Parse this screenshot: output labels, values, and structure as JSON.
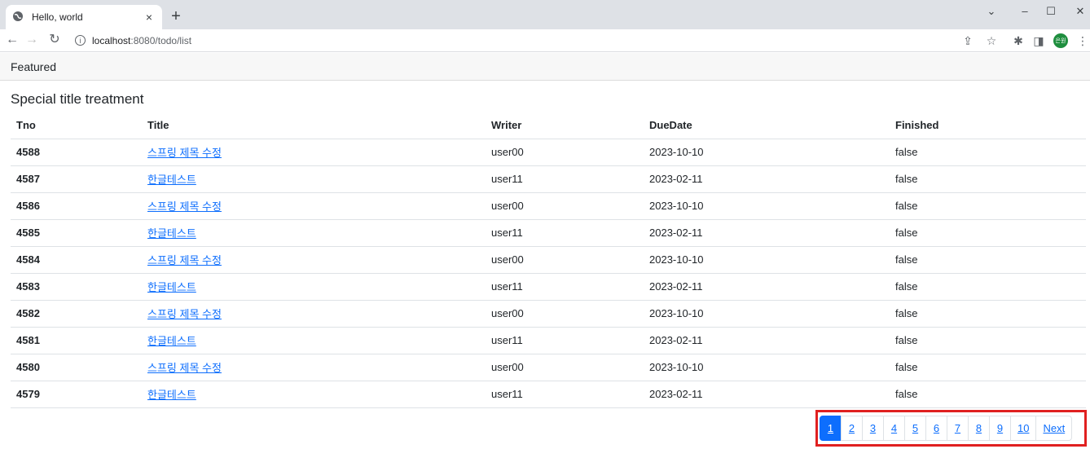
{
  "browser": {
    "tab_title": "Hello, world",
    "tab_close": "×",
    "new_tab": "+",
    "url_host": "localhost",
    "url_path": ":8080/todo/list",
    "avatar_text": "은원"
  },
  "card": {
    "header": "Featured",
    "title": "Special title treatment"
  },
  "table": {
    "columns": [
      "Tno",
      "Title",
      "Writer",
      "DueDate",
      "Finished"
    ],
    "rows": [
      {
        "tno": "4588",
        "title": "스프링 제목 수정",
        "writer": "user00",
        "dueDate": "2023-10-10",
        "finished": "false"
      },
      {
        "tno": "4587",
        "title": "한글테스트",
        "writer": "user11",
        "dueDate": "2023-02-11",
        "finished": "false"
      },
      {
        "tno": "4586",
        "title": "스프링 제목 수정",
        "writer": "user00",
        "dueDate": "2023-10-10",
        "finished": "false"
      },
      {
        "tno": "4585",
        "title": "한글테스트",
        "writer": "user11",
        "dueDate": "2023-02-11",
        "finished": "false"
      },
      {
        "tno": "4584",
        "title": "스프링 제목 수정",
        "writer": "user00",
        "dueDate": "2023-10-10",
        "finished": "false"
      },
      {
        "tno": "4583",
        "title": "한글테스트",
        "writer": "user11",
        "dueDate": "2023-02-11",
        "finished": "false"
      },
      {
        "tno": "4582",
        "title": "스프링 제목 수정",
        "writer": "user00",
        "dueDate": "2023-10-10",
        "finished": "false"
      },
      {
        "tno": "4581",
        "title": "한글테스트",
        "writer": "user11",
        "dueDate": "2023-02-11",
        "finished": "false"
      },
      {
        "tno": "4580",
        "title": "스프링 제목 수정",
        "writer": "user00",
        "dueDate": "2023-10-10",
        "finished": "false"
      },
      {
        "tno": "4579",
        "title": "한글테스트",
        "writer": "user11",
        "dueDate": "2023-02-11",
        "finished": "false"
      }
    ]
  },
  "pagination": {
    "pages": [
      "1",
      "2",
      "3",
      "4",
      "5",
      "6",
      "7",
      "8",
      "9",
      "10"
    ],
    "active": "1",
    "next_label": "Next"
  },
  "colors": {
    "link": "#0d6efd",
    "highlight": "#e02020"
  }
}
